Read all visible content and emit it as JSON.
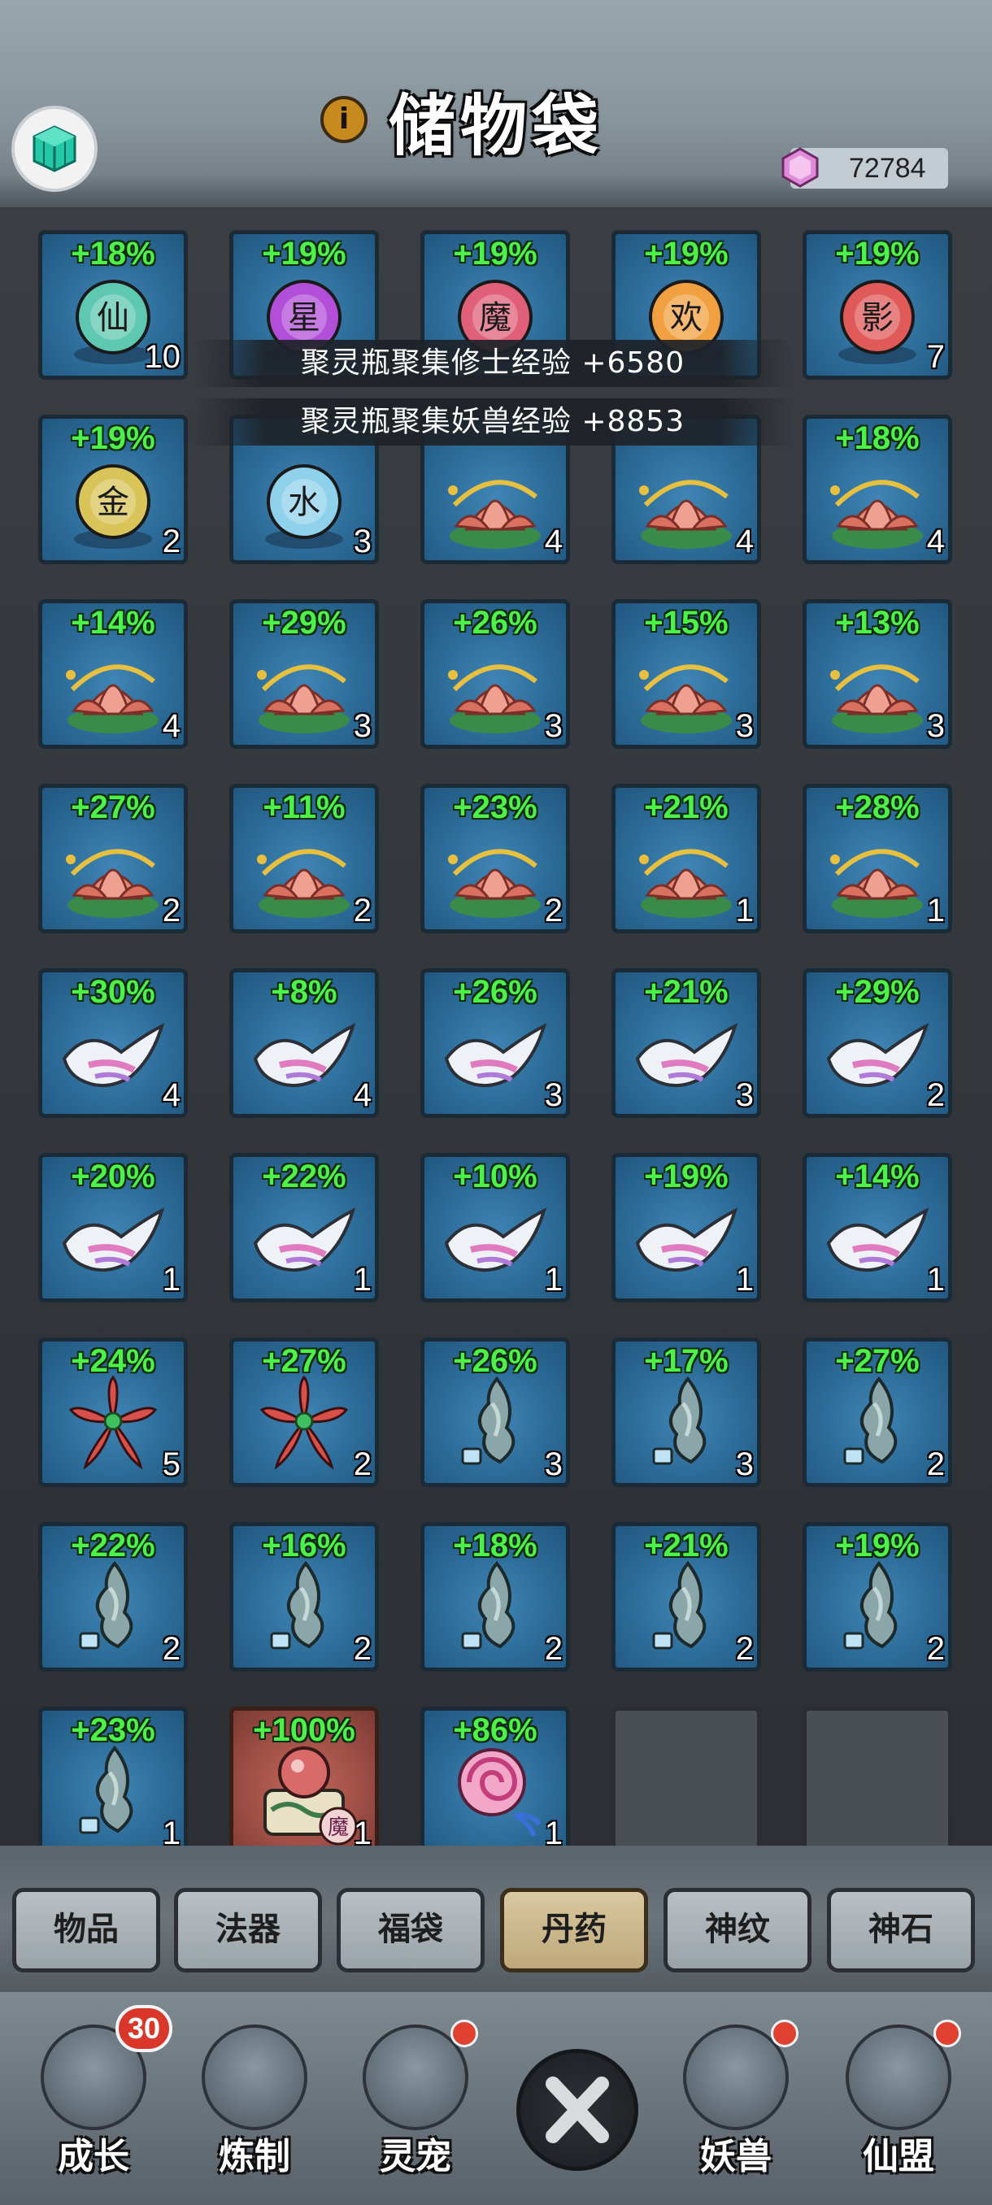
{
  "header": {
    "title": "储物袋",
    "gem_count": "72784"
  },
  "notices": [
    "聚灵瓶聚集修士经验 +6580",
    "聚灵瓶聚集妖兽经验 +8853"
  ],
  "items": [
    {
      "pct": "+18%",
      "qty": "10",
      "kind": "orb",
      "label": "仙",
      "color": "#5fc8b0"
    },
    {
      "pct": "+19%",
      "qty": "",
      "kind": "orb",
      "label": "星",
      "color": "#b24fd8"
    },
    {
      "pct": "+19%",
      "qty": "",
      "kind": "orb",
      "label": "魔",
      "color": "#e0607a"
    },
    {
      "pct": "+19%",
      "qty": "",
      "kind": "orb",
      "label": "欢",
      "color": "#f0a040"
    },
    {
      "pct": "+19%",
      "qty": "7",
      "kind": "orb",
      "label": "影",
      "color": "#e05a5a"
    },
    {
      "pct": "+19%",
      "qty": "2",
      "kind": "orb",
      "label": "金",
      "color": "#d9c45a"
    },
    {
      "pct": "",
      "qty": "3",
      "kind": "orb",
      "label": "水",
      "color": "#8fd0ea"
    },
    {
      "pct": "",
      "qty": "4",
      "kind": "lotus",
      "label": "",
      "color": ""
    },
    {
      "pct": "",
      "qty": "4",
      "kind": "lotus",
      "label": "",
      "color": ""
    },
    {
      "pct": "+18%",
      "qty": "4",
      "kind": "lotus",
      "label": "",
      "color": ""
    },
    {
      "pct": "+14%",
      "qty": "4",
      "kind": "lotus",
      "label": "",
      "color": ""
    },
    {
      "pct": "+29%",
      "qty": "3",
      "kind": "lotus",
      "label": "",
      "color": ""
    },
    {
      "pct": "+26%",
      "qty": "3",
      "kind": "lotus",
      "label": "",
      "color": ""
    },
    {
      "pct": "+15%",
      "qty": "3",
      "kind": "lotus",
      "label": "",
      "color": ""
    },
    {
      "pct": "+13%",
      "qty": "3",
      "kind": "lotus",
      "label": "",
      "color": ""
    },
    {
      "pct": "+27%",
      "qty": "2",
      "kind": "lotus",
      "label": "",
      "color": ""
    },
    {
      "pct": "+11%",
      "qty": "2",
      "kind": "lotus",
      "label": "",
      "color": ""
    },
    {
      "pct": "+23%",
      "qty": "2",
      "kind": "lotus",
      "label": "",
      "color": ""
    },
    {
      "pct": "+21%",
      "qty": "1",
      "kind": "lotus",
      "label": "",
      "color": ""
    },
    {
      "pct": "+28%",
      "qty": "1",
      "kind": "lotus",
      "label": "",
      "color": ""
    },
    {
      "pct": "+30%",
      "qty": "4",
      "kind": "fox",
      "label": "",
      "color": ""
    },
    {
      "pct": "+8%",
      "qty": "4",
      "kind": "fox",
      "label": "",
      "color": ""
    },
    {
      "pct": "+26%",
      "qty": "3",
      "kind": "fox",
      "label": "",
      "color": ""
    },
    {
      "pct": "+21%",
      "qty": "3",
      "kind": "fox",
      "label": "",
      "color": ""
    },
    {
      "pct": "+29%",
      "qty": "2",
      "kind": "fox",
      "label": "",
      "color": ""
    },
    {
      "pct": "+20%",
      "qty": "1",
      "kind": "fox",
      "label": "",
      "color": ""
    },
    {
      "pct": "+22%",
      "qty": "1",
      "kind": "fox",
      "label": "",
      "color": ""
    },
    {
      "pct": "+10%",
      "qty": "1",
      "kind": "fox",
      "label": "",
      "color": ""
    },
    {
      "pct": "+19%",
      "qty": "1",
      "kind": "fox",
      "label": "",
      "color": ""
    },
    {
      "pct": "+14%",
      "qty": "1",
      "kind": "fox",
      "label": "",
      "color": ""
    },
    {
      "pct": "+24%",
      "qty": "5",
      "kind": "flower",
      "label": "",
      "color": ""
    },
    {
      "pct": "+27%",
      "qty": "2",
      "kind": "flower",
      "label": "",
      "color": ""
    },
    {
      "pct": "+26%",
      "qty": "3",
      "kind": "pendant",
      "label": "",
      "color": ""
    },
    {
      "pct": "+17%",
      "qty": "3",
      "kind": "pendant",
      "label": "",
      "color": ""
    },
    {
      "pct": "+27%",
      "qty": "2",
      "kind": "pendant",
      "label": "",
      "color": ""
    },
    {
      "pct": "+22%",
      "qty": "2",
      "kind": "pendant",
      "label": "",
      "color": ""
    },
    {
      "pct": "+16%",
      "qty": "2",
      "kind": "pendant",
      "label": "",
      "color": ""
    },
    {
      "pct": "+18%",
      "qty": "2",
      "kind": "pendant",
      "label": "",
      "color": ""
    },
    {
      "pct": "+21%",
      "qty": "2",
      "kind": "pendant",
      "label": "",
      "color": ""
    },
    {
      "pct": "+19%",
      "qty": "2",
      "kind": "pendant",
      "label": "",
      "color": ""
    },
    {
      "pct": "+23%",
      "qty": "1",
      "kind": "pendant",
      "label": "",
      "color": ""
    },
    {
      "pct": "+100%",
      "qty": "1",
      "kind": "drum",
      "label": "魔",
      "color": ""
    },
    {
      "pct": "+86%",
      "qty": "1",
      "kind": "candy",
      "label": "",
      "color": ""
    },
    {
      "pct": "",
      "qty": "",
      "kind": "empty",
      "label": "",
      "color": ""
    },
    {
      "pct": "",
      "qty": "",
      "kind": "empty",
      "label": "",
      "color": ""
    }
  ],
  "tabs": [
    {
      "label": "物品",
      "active": false
    },
    {
      "label": "法器",
      "active": false
    },
    {
      "label": "福袋",
      "active": false
    },
    {
      "label": "丹药",
      "active": true
    },
    {
      "label": "神纹",
      "active": false
    },
    {
      "label": "神石",
      "active": false
    }
  ],
  "nav": [
    {
      "label": "成长",
      "badge": "30",
      "dot": false,
      "icon": "armor-icon"
    },
    {
      "label": "炼制",
      "badge": "",
      "dot": false,
      "icon": "furnace-icon"
    },
    {
      "label": "灵宠",
      "badge": "",
      "dot": true,
      "icon": "pet-icon"
    },
    {
      "label": "妖兽",
      "badge": "",
      "dot": true,
      "icon": "beast-icon"
    },
    {
      "label": "仙盟",
      "badge": "",
      "dot": true,
      "icon": "pagoda-icon"
    }
  ],
  "colors": {
    "percent_green": "#4ef04a",
    "slot_blue": "#2f6f9c",
    "tab_active": "#d9c8a1",
    "badge_red": "#d9372a"
  }
}
